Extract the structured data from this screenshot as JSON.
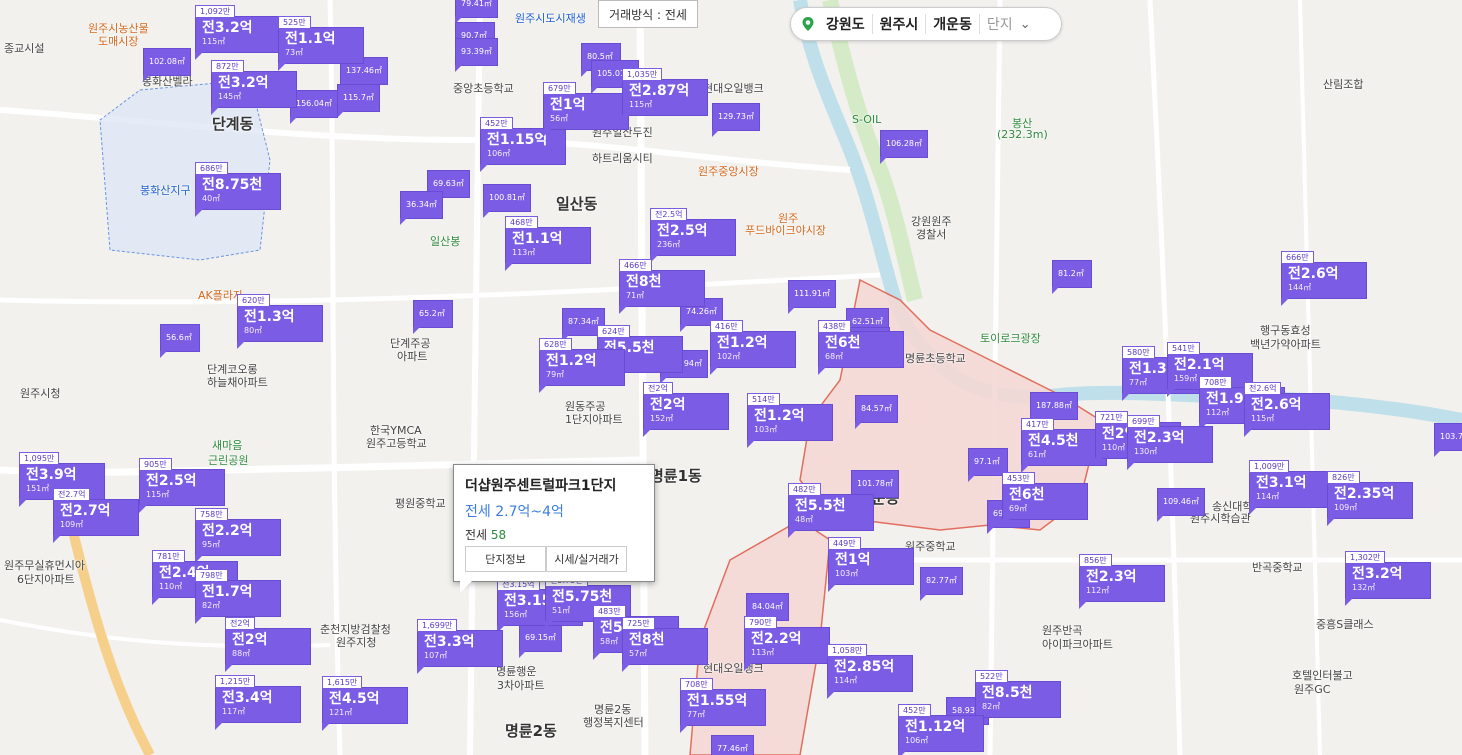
{
  "trade_type": "거래방식 : 전세",
  "breadcrumb": {
    "items": [
      "강원도",
      "원주시",
      "개운동"
    ],
    "last": "단지",
    "pin_color": "#2aa34a"
  },
  "popup": {
    "title": "더샵원주센트럴파크1단지",
    "range": "전세 2.7억~4억",
    "count_label": "전세",
    "count": "58",
    "buttons": [
      "단지정보",
      "시세/실거래가"
    ]
  },
  "places": [
    {
      "t": "단계동",
      "c": "big"
    },
    {
      "t": "일산동",
      "c": "big"
    },
    {
      "t": "개운동",
      "c": "big"
    },
    {
      "t": "명륜1동",
      "c": "big"
    },
    {
      "t": "명륜2동",
      "c": "big"
    },
    {
      "t": "원주시도시재생",
      "c": "blue"
    },
    {
      "t": "봉화산지구",
      "c": "blue"
    },
    {
      "t": "원주시농산물",
      "c": "orange"
    },
    {
      "t": "도매시장",
      "c": "orange"
    },
    {
      "t": "원주중앙시장",
      "c": "orange"
    },
    {
      "t": "원주",
      "c": "orange"
    },
    {
      "t": "푸드바이크야시장",
      "c": "orange"
    },
    {
      "t": "AK플라자",
      "c": "orange"
    },
    {
      "t": "봉산",
      "c": "green"
    },
    {
      "t": "(232.3m)",
      "c": "green"
    },
    {
      "t": "S-OIL",
      "c": "green"
    },
    {
      "t": "토이로크광장",
      "c": "green"
    },
    {
      "t": "일산봉",
      "c": "green"
    },
    {
      "t": "새마음",
      "c": "green"
    },
    {
      "t": "근린공원",
      "c": "green"
    },
    {
      "t": "중앙초등학교",
      "c": ""
    },
    {
      "t": "현대오일뱅크",
      "c": ""
    },
    {
      "t": "원주시청",
      "c": ""
    },
    {
      "t": "강원원주",
      "c": ""
    },
    {
      "t": "경찰서",
      "c": ""
    },
    {
      "t": "단계주공",
      "c": ""
    },
    {
      "t": "아파트",
      "c": ""
    },
    {
      "t": "한국YMCA",
      "c": ""
    },
    {
      "t": "원주고등학교",
      "c": ""
    },
    {
      "t": "평원중학교",
      "c": ""
    },
    {
      "t": "명륜초등학교",
      "c": ""
    },
    {
      "t": "원주중학교",
      "c": ""
    },
    {
      "t": "원동주공",
      "c": ""
    },
    {
      "t": "1단지아파트",
      "c": ""
    },
    {
      "t": "산림조합",
      "c": ""
    },
    {
      "t": "행구동효성",
      "c": ""
    },
    {
      "t": "백년가약아파트",
      "c": ""
    },
    {
      "t": "반곡중학교",
      "c": ""
    },
    {
      "t": "원주반곡",
      "c": ""
    },
    {
      "t": "아이파크아파트",
      "c": ""
    },
    {
      "t": "중흥S클래스",
      "c": ""
    },
    {
      "t": "호텔인터불고",
      "c": ""
    },
    {
      "t": "원주GC",
      "c": ""
    },
    {
      "t": "춘천지방검찰청",
      "c": ""
    },
    {
      "t": "원주지청",
      "c": ""
    },
    {
      "t": "명륜행운",
      "c": ""
    },
    {
      "t": "3차아파트",
      "c": ""
    },
    {
      "t": "명륜2동",
      "c": ""
    },
    {
      "t": "행정복지센터",
      "c": ""
    },
    {
      "t": "원주무실휴먼시아",
      "c": ""
    },
    {
      "t": "6단지아파트",
      "c": ""
    },
    {
      "t": "단계코오롱",
      "c": ""
    },
    {
      "t": "하늘채아파트",
      "c": ""
    },
    {
      "t": "봉화산벨라",
      "c": ""
    },
    {
      "t": "원주일산두진",
      "c": ""
    },
    {
      "t": "하트리움시티",
      "c": ""
    },
    {
      "t": "현대오일뱅크",
      "c": ""
    },
    {
      "t": "종교시설",
      "c": ""
    },
    {
      "t": "송신대학",
      "c": ""
    },
    {
      "t": "원주시학습관",
      "c": ""
    }
  ],
  "markers": [
    {
      "tag": "1,092만",
      "price": "전3.2억",
      "area": "115㎡"
    },
    {
      "tag": "525만",
      "price": "전1.1억",
      "area": "73㎡"
    },
    {
      "tag": "872만",
      "price": "전3.2억",
      "area": "145㎡"
    },
    {
      "tag": "452만",
      "price": "전1.15억",
      "area": "106㎡"
    },
    {
      "tag": "679만",
      "price": "전1억",
      "area": "56㎡"
    },
    {
      "tag": "1,035만",
      "price": "전2.87억",
      "area": "115㎡"
    },
    {
      "tag": "686만",
      "price": "전8.75천",
      "area": "40㎡"
    },
    {
      "tag": "468만",
      "price": "전1.1억",
      "area": "113㎡"
    },
    {
      "tag": "전2.5억",
      "price": "전2.5억",
      "area": "236㎡"
    },
    {
      "tag": "466만",
      "price": "전8천",
      "area": "71㎡"
    },
    {
      "tag": "620만",
      "price": "전1.3억",
      "area": "80㎡"
    },
    {
      "tag": "624만",
      "price": "전5.5천",
      "area": "55㎡"
    },
    {
      "tag": "628만",
      "price": "전1.2억",
      "area": "79㎡"
    },
    {
      "tag": "416만",
      "price": "전1.2억",
      "area": "102㎡"
    },
    {
      "tag": "438만",
      "price": "전6천",
      "area": "68㎡"
    },
    {
      "tag": "666만",
      "price": "전2.6억",
      "area": "144㎡"
    },
    {
      "tag": "전2억",
      "price": "전2억",
      "area": "152㎡"
    },
    {
      "tag": "514만",
      "price": "전1.2억",
      "area": "103㎡"
    },
    {
      "tag": "580만",
      "price": "전1.3억",
      "area": "77㎡"
    },
    {
      "tag": "541만",
      "price": "전2.1억",
      "area": "159㎡"
    },
    {
      "tag": "708만",
      "price": "전1.9억",
      "area": "112㎡"
    },
    {
      "tag": "전2.6억",
      "price": "전2.6억",
      "area": "115㎡"
    },
    {
      "tag": "417만",
      "price": "전4.5천",
      "area": "61㎡"
    },
    {
      "tag": "721만",
      "price": "전2억",
      "area": "110㎡"
    },
    {
      "tag": "699만",
      "price": "전2.3억",
      "area": "130㎡"
    },
    {
      "tag": "1,095만",
      "price": "전3.9억",
      "area": "151㎡"
    },
    {
      "tag": "905만",
      "price": "전2.5억",
      "area": "115㎡"
    },
    {
      "tag": "전2.7억",
      "price": "전2.7억",
      "area": "109㎡"
    },
    {
      "tag": "482만",
      "price": "전5.5천",
      "area": "48㎡"
    },
    {
      "tag": "453만",
      "price": "전6천",
      "area": "69㎡"
    },
    {
      "tag": "1,009만",
      "price": "전3.1억",
      "area": "114㎡"
    },
    {
      "tag": "826만",
      "price": "전2.35억",
      "area": "109㎡"
    },
    {
      "tag": "758만",
      "price": "전2.2억",
      "area": "95㎡"
    },
    {
      "tag": "781만",
      "price": "전2.4억",
      "area": "110㎡"
    },
    {
      "tag": "798만",
      "price": "전1.7억",
      "area": "82㎡"
    },
    {
      "tag": "449만",
      "price": "전1억",
      "area": "103㎡"
    },
    {
      "tag": "856만",
      "price": "전2.3억",
      "area": "112㎡"
    },
    {
      "tag": "1,302만",
      "price": "전3.2억",
      "area": "132㎡"
    },
    {
      "tag": "전3.15억",
      "price": "전3.15억",
      "area": "156㎡"
    },
    {
      "tag": "전5.75천",
      "price": "전5.75천",
      "area": "51㎡"
    },
    {
      "tag": "483만",
      "price": "전5천",
      "area": "58㎡"
    },
    {
      "tag": "725만",
      "price": "전8천",
      "area": "57㎡"
    },
    {
      "tag": "1,699만",
      "price": "전3.3억",
      "area": "107㎡"
    },
    {
      "tag": "전2억",
      "price": "전2억",
      "area": "88㎡"
    },
    {
      "tag": "790만",
      "price": "전2.2억",
      "area": "113㎡"
    },
    {
      "tag": "1,058만",
      "price": "전2.85억",
      "area": "114㎡"
    },
    {
      "tag": "1,215만",
      "price": "전3.4억",
      "area": "117㎡"
    },
    {
      "tag": "1,615만",
      "price": "전4.5억",
      "area": "121㎡"
    },
    {
      "tag": "708만",
      "price": "전1.55억",
      "area": "77㎡"
    },
    {
      "tag": "522만",
      "price": "전8.5천",
      "area": "82㎡"
    },
    {
      "tag": "452만",
      "price": "전1.12억",
      "area": "106㎡"
    }
  ],
  "area_markers": [
    "79.41㎡",
    "90.7㎡",
    "93.39㎡",
    "102.08㎡",
    "137.46㎡",
    "115.7㎡",
    "156.04㎡",
    "80.5㎡",
    "105.01㎡",
    "129.73㎡",
    "106.28㎡",
    "69.63㎡",
    "36.34㎡",
    "100.81㎡",
    "87.34㎡",
    "110.94㎡",
    "111.91㎡",
    "62.51㎡",
    "63.77㎡",
    "65.2㎡",
    "56.6㎡",
    "81.2㎡",
    "84.57㎡",
    "187.88㎡",
    "97.1㎡",
    "101.78㎡",
    "69.32㎡",
    "109.46㎡",
    "82.77㎡",
    "84.04㎡",
    "69.15㎡",
    "58.93㎡",
    "77.46㎡",
    "103.7㎡",
    "74.26㎡"
  ]
}
